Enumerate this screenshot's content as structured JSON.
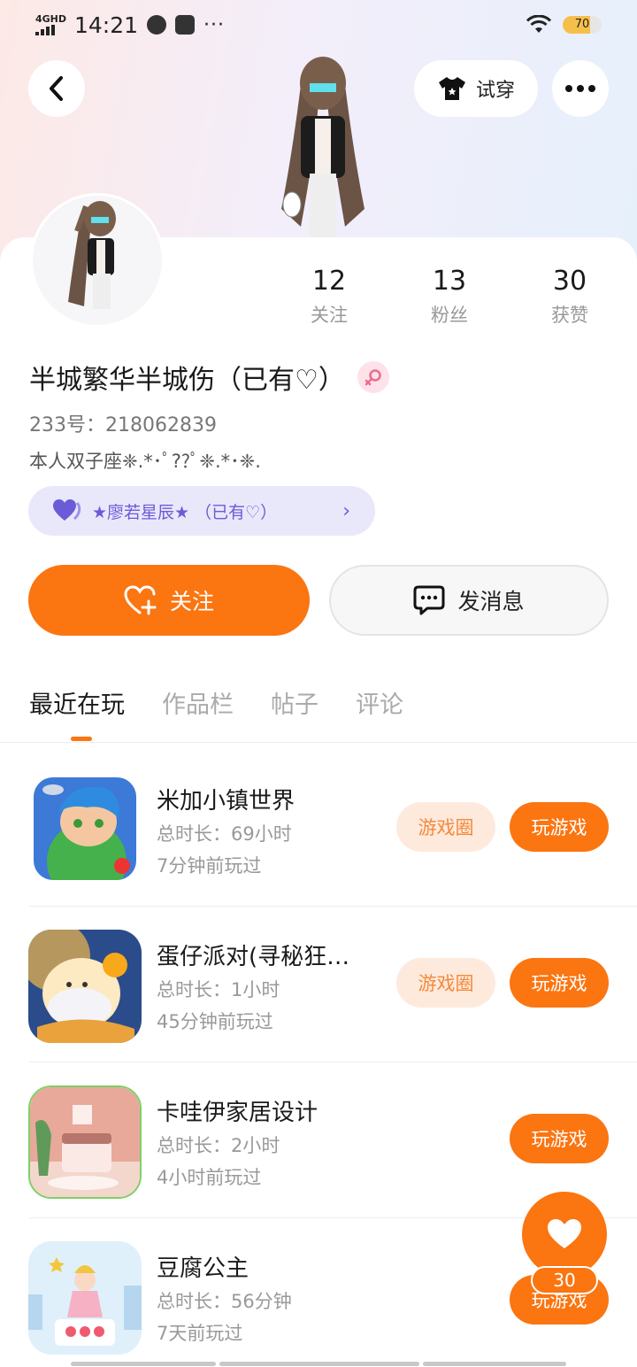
{
  "status_bar": {
    "network": "4GHD",
    "time": "14:21",
    "dots": "···",
    "battery": "70"
  },
  "header": {
    "try_on_label": "试穿"
  },
  "profile": {
    "stats": [
      {
        "value": "12",
        "label": "关注"
      },
      {
        "value": "13",
        "label": "粉丝"
      },
      {
        "value": "30",
        "label": "获赞"
      }
    ],
    "name": "半城繁华半城伤（已有♡）",
    "uid": "233号：218062839",
    "bio": "本人双子座❈.*･ﾟ??ﾟ❈.*･❈.",
    "badge_text": "★廖若星辰★ （已有♡）",
    "badge_chevron": "›"
  },
  "actions": {
    "follow_label": "关注",
    "message_label": "发消息"
  },
  "tabs": [
    {
      "label": "最近在玩",
      "active": true
    },
    {
      "label": "作品栏",
      "active": false
    },
    {
      "label": "帖子",
      "active": false
    },
    {
      "label": "评论",
      "active": false
    }
  ],
  "games": [
    {
      "name": "米加小镇世界",
      "duration": "总时长：69小时",
      "last_played": "7分钟前玩过",
      "circle_label": "游戏圈",
      "play_label": "玩游戏"
    },
    {
      "name": "蛋仔派对(寻秘狂…",
      "duration": "总时长：1小时",
      "last_played": "45分钟前玩过",
      "circle_label": "游戏圈",
      "play_label": "玩游戏"
    },
    {
      "name": "卡哇伊家居设计",
      "duration": "总时长：2小时",
      "last_played": "4小时前玩过",
      "play_label": "玩游戏"
    },
    {
      "name": "豆腐公主",
      "duration": "总时长：56分钟",
      "last_played": "7天前玩过",
      "play_label": "玩游戏"
    }
  ],
  "like_fab": {
    "count": "30"
  },
  "colors": {
    "accent": "#fb7511",
    "badge_bg": "#e9e8fb",
    "badge_text": "#6a5cd6"
  }
}
